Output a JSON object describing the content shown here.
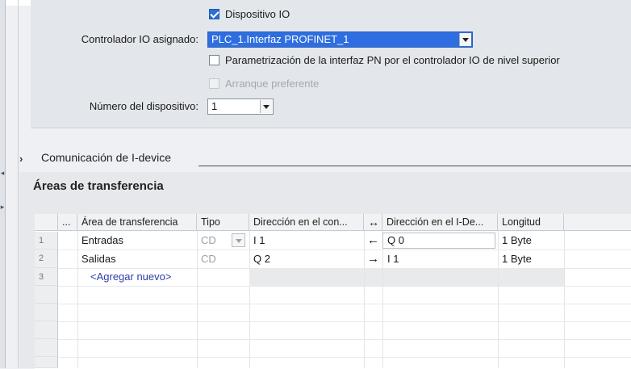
{
  "panel": {
    "io_device_label": "Dispositivo IO",
    "io_device_checked": true,
    "controller_label": "Controlador IO asignado:",
    "controller_value": "PLC_1.Interfaz PROFINET_1",
    "param_label": "Parametrización de la interfaz PN por el controlador IO de nivel superior",
    "param_checked": false,
    "priority_label": "Arranque preferente",
    "priority_checked": false,
    "device_number_label": "Número del dispositivo:",
    "device_number_value": "1"
  },
  "section": {
    "chevron": "›",
    "title": "Comunicación de I-device"
  },
  "transfer": {
    "title": "Áreas de transferencia",
    "columns": {
      "dots": "...",
      "area": "Área de transferencia",
      "tipo": "Tipo",
      "dir_con": "Dirección en el con...",
      "arrows": "↔",
      "dir_idev": "Dirección en el I-De...",
      "longitud": "Longitud"
    },
    "rows": [
      {
        "num": "1",
        "area": "Entradas",
        "tipo": "CD",
        "dir_con": "I 1",
        "arrow": "←",
        "dir_idev": "Q 0",
        "longitud": "1 Byte"
      },
      {
        "num": "2",
        "area": "Salidas",
        "tipo": "CD",
        "dir_con": "Q 2",
        "arrow": "→",
        "dir_idev": "I 1",
        "longitud": "1 Byte"
      },
      {
        "num": "3",
        "area": "<Agregar nuevo>"
      }
    ]
  }
}
